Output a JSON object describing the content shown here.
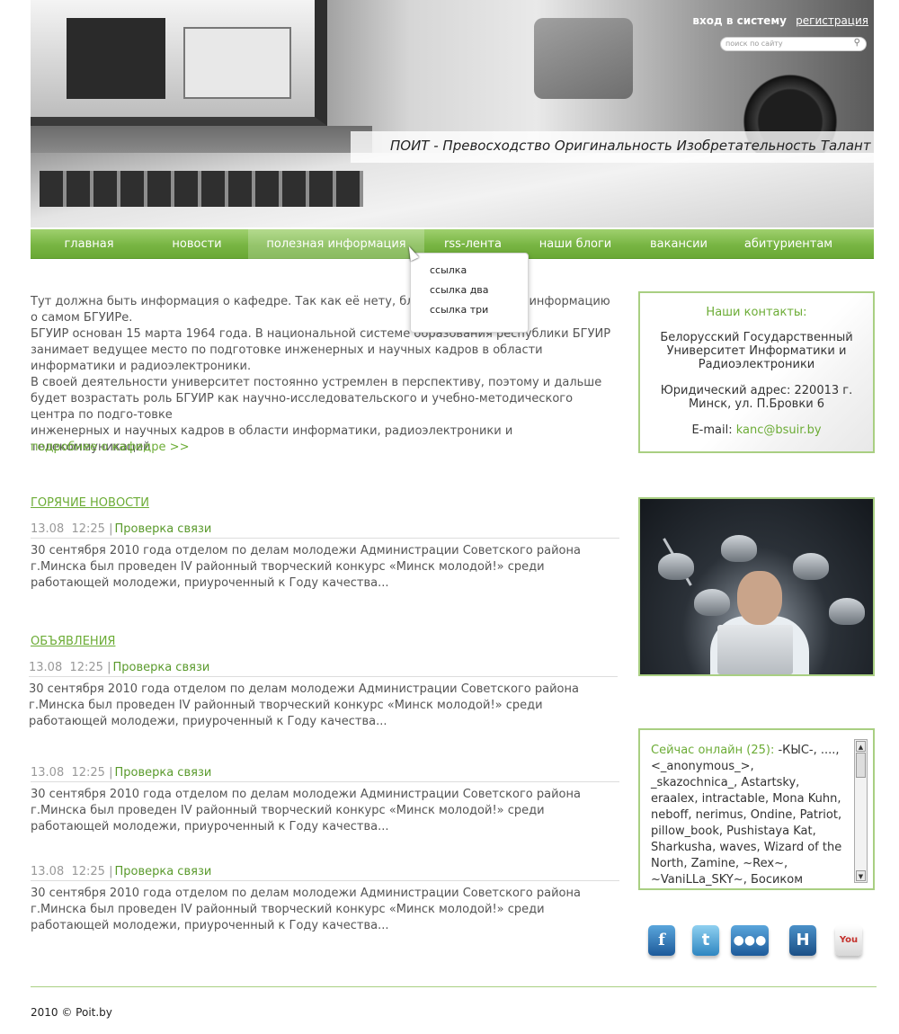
{
  "header": {
    "login": "вход в систему",
    "register": "регистрация",
    "search_placeholder": "поиск по сайту",
    "slogan": "ПОИТ - Превосходство Оригинальность Изобретательность Талант"
  },
  "nav": {
    "items": [
      "главная",
      "новости",
      "полезная информация",
      "rss-лента",
      "наши блоги",
      "вакансии",
      "абитуриентам"
    ],
    "active": "полезная информация",
    "dropdown": [
      "ссылка",
      "ссылка два",
      "ссылка три"
    ]
  },
  "about": {
    "p1": "Тут должна быть информация о кафедре. Так как её нету, благопо... приводим информацию о самом БГУИРе.",
    "p2": "БГУИР основан 15 марта 1964 года. В национальной системе образования республики БГУИР занимает ведущее место по подготовке инженерных и научных кадров в области информатики и радиоэлектроники.",
    "p3": "В своей деятельности университет постоянно устремлен в перспективу, поэтому и дальше будет возрастать роль БГУИР как научно-исследовательского и учебно-методического центра по подго-товке",
    "p4": " инженерных и научных кадров в области информатики, радиоэлектроники и телекоммуникаций",
    "more": "подробнее о кафедре >>"
  },
  "hot_news": {
    "title": "ГОРЯЧИЕ НОВОСТИ",
    "date": "13.08",
    "time": "12:25",
    "link": "Проверка связи",
    "text": "30 сентября 2010 года отделом по делам молодежи Администрации Советского района г.Минска был проведен IV районный творческий конкурс «Минск молодой!» среди работающей молодежи, приуроченный к Году качества..."
  },
  "announcements": {
    "title": "ОБЪЯВЛЕНИЯ",
    "items": [
      {
        "date": "13.08",
        "time": "12:25",
        "link": "Проверка связи",
        "text": "30 сентября 2010 года отделом по делам молодежи Администрации Советского района г.Минска был проведен IV районный творческий конкурс «Минск молодой!» среди работающей молодежи, приуроченный к Году качества..."
      },
      {
        "date": "13.08",
        "time": "12:25",
        "link": "Проверка связи",
        "text": "30 сентября 2010 года отделом по делам молодежи Администрации Советского района г.Минска был проведен IV районный творческий конкурс «Минск молодой!» среди работающей молодежи, приуроченный к Году качества..."
      },
      {
        "date": "13.08",
        "time": "12:25",
        "link": "Проверка связи",
        "text": "30 сентября 2010 года отделом по делам молодежи Администрации Советского района г.Минска был проведен IV районный творческий конкурс «Минск молодой!» среди работающей молодежи, приуроченный к Году качества..."
      }
    ]
  },
  "contacts": {
    "title": "Наши контакты:",
    "org": "Белорусский Государственный Университет Информатики и Радиоэлектроники",
    "address": "Юридический адрес: 220013 г. Минск, ул. П.Бровки 6",
    "email_label": "E-mail:",
    "email": "kanc@bsuir.by"
  },
  "online": {
    "label": "Сейчас онлайн (25):",
    "users": " -КЫС-, ....,  <_anonymous_>, _skazochnica_, Astartsky, eraalex, intractable, Mona Kuhn, neboff, nerimus, Ondine, Patriot, pillow_book, Pushistaya Kat, Sharkusha, waves, Wizard of the North, Zamine, ~Rex~, ~VaniLLa_SKY~, Босиком"
  },
  "social": [
    "facebook-icon",
    "twitter-icon",
    "myspace-icon",
    "hyves-icon",
    "youtube-icon"
  ],
  "footer": "2010 © Poit.by",
  "colors": {
    "accent": "#6cac36",
    "nav": "#78b543",
    "border": "#a9cf82"
  }
}
